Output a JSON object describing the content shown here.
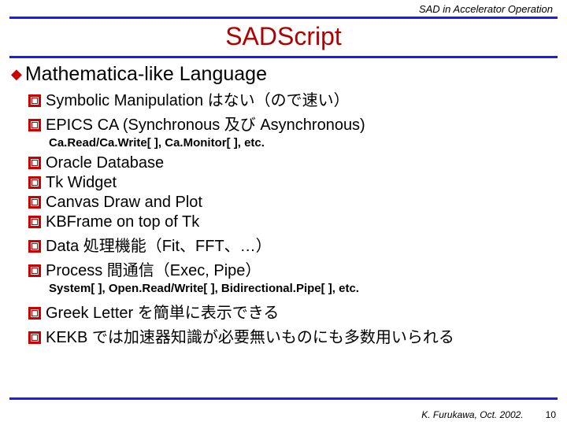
{
  "header": "SAD in Accelerator Operation",
  "title": "SADScript",
  "section": "Mathematica-like Language",
  "items": [
    "Symbolic Manipulation はない（ので速い）",
    "EPICS CA (Synchronous 及び Asynchronous)"
  ],
  "sub1": "Ca.Read/Ca.Write[ ], Ca.Monitor[ ], etc.",
  "items2": [
    "Oracle Database",
    "Tk Widget",
    "Canvas Draw and Plot",
    "KBFrame on top of Tk",
    "Data 処理機能（Fit、FFT、…）",
    "Process 間通信（Exec, Pipe）"
  ],
  "sub2": "System[ ], Open.Read/Write[ ], Bidirectional.Pipe[ ], etc.",
  "items3": [
    "Greek Letter を簡単に表示できる",
    "KEKB では加速器知識が必要無いものにも多数用いられる"
  ],
  "footer_author": "K. Furukawa, Oct. 2002.",
  "footer_page": "10"
}
